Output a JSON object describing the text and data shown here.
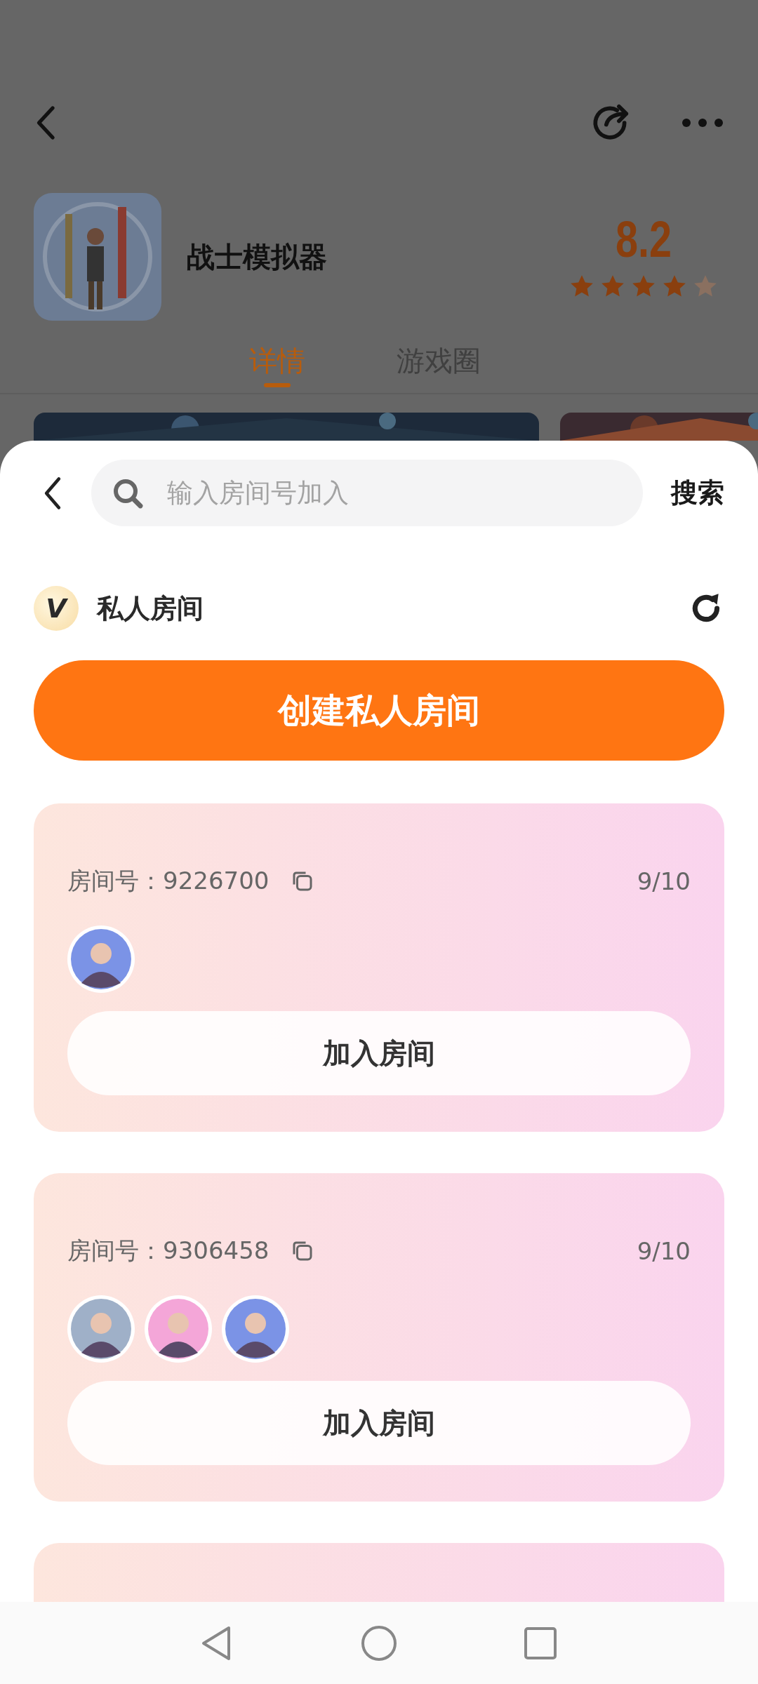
{
  "game": {
    "title": "战士模拟器",
    "rating": "8.2",
    "stars": 4
  },
  "tabs": [
    {
      "label": "详情",
      "selected": true
    },
    {
      "label": "游戏圈",
      "selected": false
    }
  ],
  "sheet": {
    "search": {
      "placeholder": "输入房间号加入"
    },
    "search_button": "搜索",
    "section": {
      "badge": "V",
      "title": "私人房间"
    },
    "create_button": "创建私人房间",
    "rooms": [
      {
        "kind": "full",
        "label": "房间号：",
        "number": "9226700",
        "count": "9/10",
        "join_button": "加入房间"
      },
      {
        "kind": "full",
        "label": "房间号：",
        "number": "9306458",
        "count": "9/10",
        "join_button": "加入房间"
      },
      {
        "kind": "cut-off"
      }
    ]
  }
}
